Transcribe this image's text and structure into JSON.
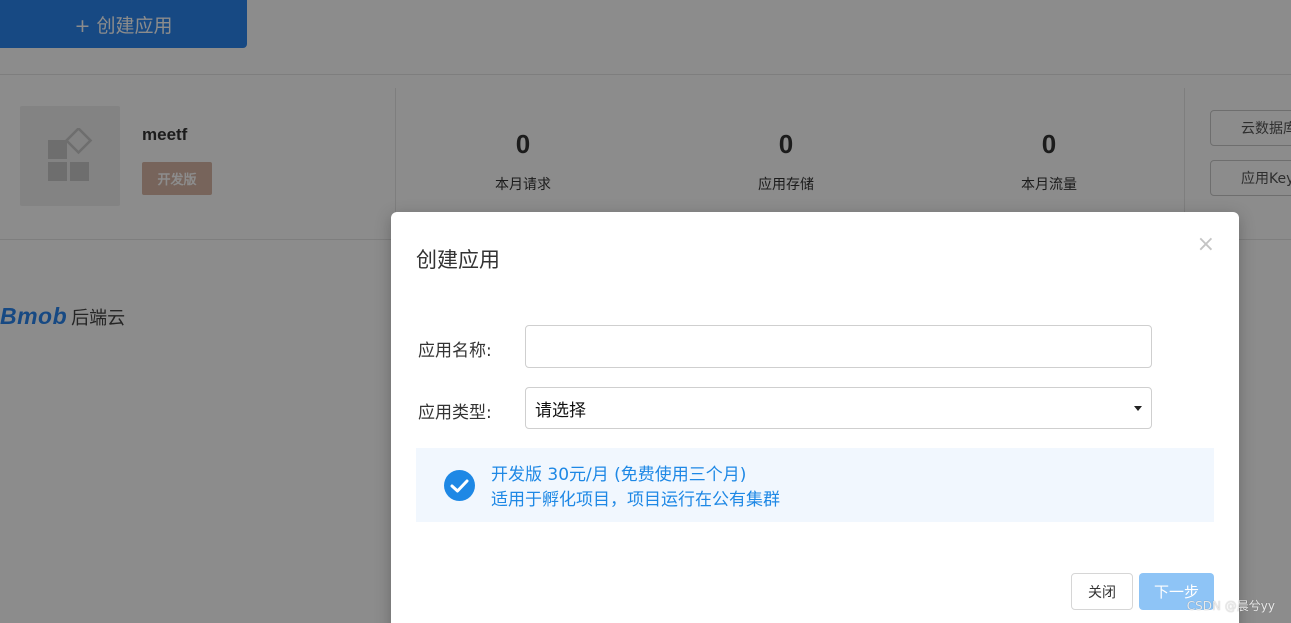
{
  "background": {
    "create_button": "+ 创建应用",
    "app": {
      "name": "meetf",
      "badge": "开发版",
      "stats": [
        {
          "value": "0",
          "label": "本月请求"
        },
        {
          "value": "0",
          "label": "应用存储"
        },
        {
          "value": "0",
          "label": "本月流量"
        }
      ],
      "side_buttons": [
        "云数据库",
        "应用Key"
      ]
    },
    "brand": {
      "mark": "Bmob",
      "text": "后端云"
    }
  },
  "modal": {
    "title": "创建应用",
    "close_icon": "×",
    "name_label": "应用名称:",
    "name_value": "",
    "name_placeholder": "",
    "type_label": "应用类型:",
    "type_value": "请选择",
    "plan": {
      "line1": "开发版 30元/月 (免费使用三个月)",
      "line2": "适用于孵化项目，项目运行在公有集群",
      "checked": true
    },
    "close_button": "关闭",
    "next_button": "下一步"
  },
  "watermark": "CSDN @晨兮yy",
  "colors": {
    "primary": "#2a86ee",
    "plan_text": "#1e88e5",
    "plan_bg": "#f1f7fe",
    "next_button_disabled": "#8ec4f6",
    "overlay": "rgba(0,0,0,0.45)"
  }
}
